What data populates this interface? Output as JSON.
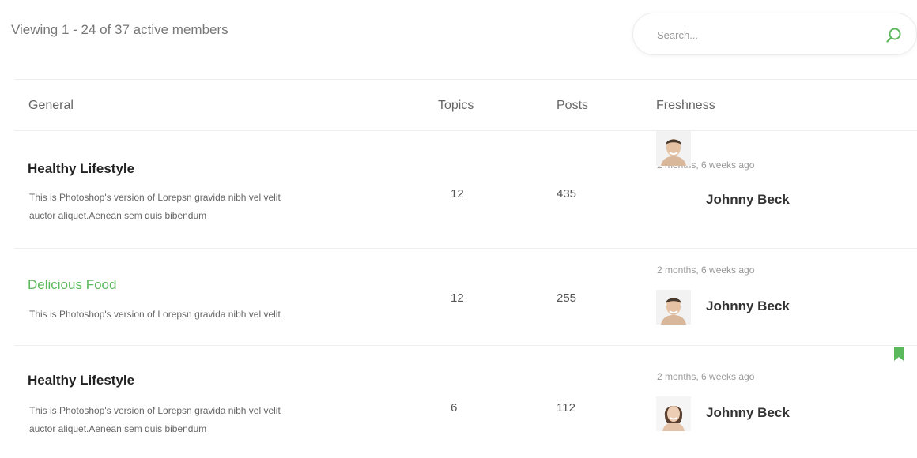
{
  "header": {
    "viewing_text": "Viewing 1 - 24 of 37 active members"
  },
  "search": {
    "placeholder": "Search...",
    "value": "",
    "icon": "search-icon"
  },
  "table": {
    "columns": [
      "General",
      "Topics",
      "Posts",
      "Freshness"
    ],
    "rows": [
      {
        "title": "Healthy Lifestyle",
        "title_color": "#222222",
        "description_lines": [
          "This is Photoshop's version  of Lorepsn gravida nibh vel velit",
          "auctor aliquet.Aenean sem quis bibendum"
        ],
        "topics": "12",
        "posts": "435",
        "freshness": "2 months, 6 weeks ago",
        "author": "Johnny Beck",
        "avatar": "male-avatar"
      },
      {
        "title": "Delicious Food",
        "title_color": "#5cb85c",
        "description_lines": [
          "This is Photoshop's version  of Lorepsn gravida nibh vel velit"
        ],
        "topics": "12",
        "posts": "255",
        "freshness": "2 months, 6 weeks ago",
        "author": "Johnny Beck",
        "avatar": "male-avatar"
      },
      {
        "title": "Healthy Lifestyle",
        "title_color": "#222222",
        "description_lines": [
          "This is Photoshop's version  of Lorepsn gravida nibh vel velit",
          "auctor aliquet.Aenean sem quis bibendum"
        ],
        "topics": "6",
        "posts": "112",
        "freshness": "2 months, 6 weeks ago",
        "author": "Johnny Beck",
        "avatar": "female-avatar",
        "bookmarked": true,
        "bookmark_icon": "bookmark-icon"
      }
    ]
  },
  "colors": {
    "accent": "#5cb85c",
    "text": "#333333",
    "muted": "#999999",
    "border": "#eeeeee"
  }
}
